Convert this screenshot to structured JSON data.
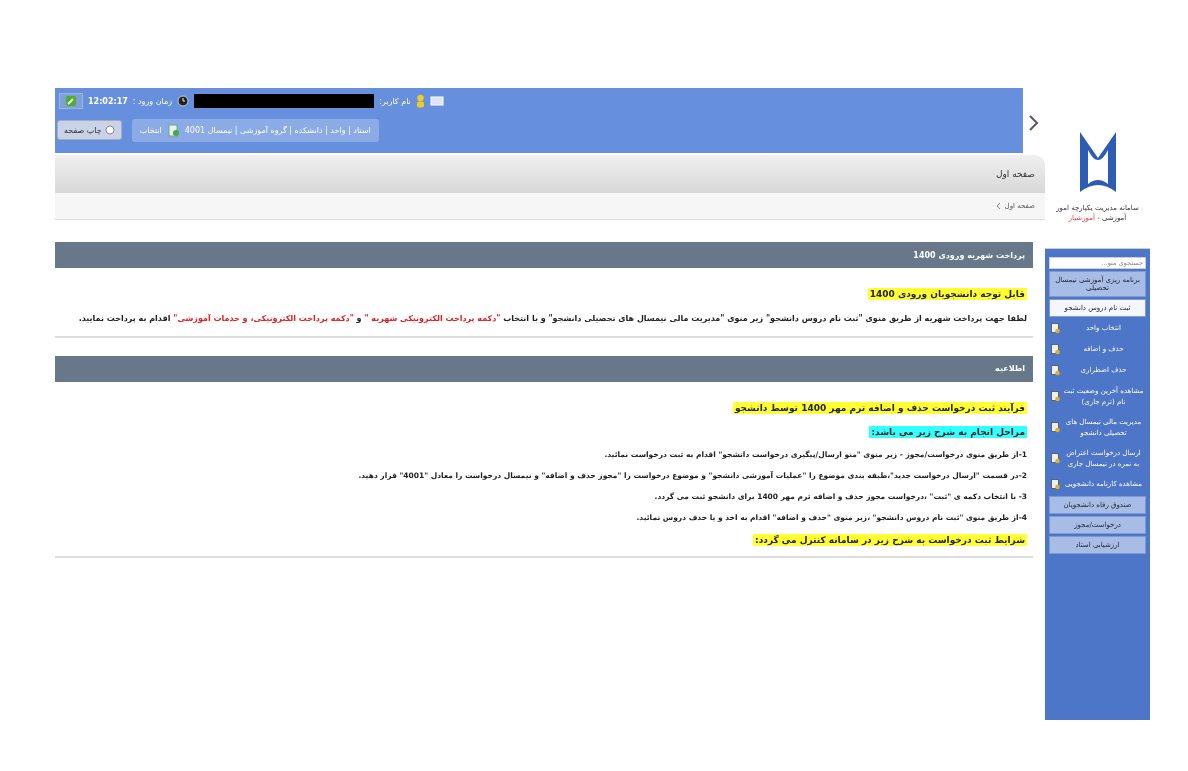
{
  "header": {
    "user_label": "نام کاربر:",
    "login_label": "زمان ورود :",
    "login_time": "12:02:17"
  },
  "toolbar": {
    "context": "استاد | واحد | دانشکده | گروه آموزشی | نیمسال 4001",
    "select_button": "انتخاب",
    "print_button": "چاپ صفحه"
  },
  "page_title": "صفحه اول",
  "breadcrumb": "صفحه اول",
  "panels": [
    {
      "title": "پرداخت شهریه ورودی 1400",
      "blocks": [
        {
          "kind": "highlight",
          "color": "#ffff33",
          "text": "قابل توجه دانشجویان ورودی 1400"
        },
        {
          "kind": "paragraph",
          "segments": [
            {
              "text": "لطفا جهت پرداخت شهریه از طریق منوی \"ثبت نام دروس دانشجو\" زیر منوی \"مدیریت مالی نیمسال های تحصیلی دانشجو\" و با انتخاب ",
              "emphasis": false
            },
            {
              "text": "\"دکمه پرداخت الکترونیکی شهریه \"",
              "emphasis": true
            },
            {
              "text": " و ",
              "emphasis": false
            },
            {
              "text": "\"دکمه پرداخت الکترونیکی، و خدمات آموزشی\"",
              "emphasis": true
            },
            {
              "text": " اقدام به پرداخت نمایید.",
              "emphasis": false
            }
          ]
        }
      ]
    },
    {
      "title": "اطلاعیه",
      "blocks": [
        {
          "kind": "highlight",
          "color": "#ffff33",
          "text": "فرآیند ثبت درخواست حذف و اضافه ترم مهر 1400 توسط دانشجو"
        },
        {
          "kind": "highlight",
          "color": "#33ffff",
          "text": "مراحل انجام به شرح زیر می باشد:"
        },
        {
          "kind": "step",
          "text": "1-از طریق منوی درخواست/مجوز - زیر منوی \"منو ارسال/پیگیری درخواست دانشجو\" اقدام به ثبت درخواست نمائید."
        },
        {
          "kind": "step",
          "text": "2-در قسمت \"ارسال درخواست جدید\"،طبقه بندی موضوع را \"عملیات آموزشی دانشجو\" و موضوع درخواست را \"مجوز حذف و اضافه\" و نیمسال درخواست را معادل \"4001\" قرار دهید."
        },
        {
          "kind": "step",
          "text": "3- با انتخاب دکمه ی \"ثبت\" ،درخواست مجوز حذف و اضافه ترم مهر 1400 برای دانشجو ثبت می گردد."
        },
        {
          "kind": "step",
          "text": "4-از طریق منوی \"ثبت نام دروس دانشجو\" ،زیر منوی \"حذف و اضافه\" اقدام به اخذ و یا حذف دروس نمائید."
        },
        {
          "kind": "highlight",
          "color": "#ffff33",
          "text": "شرایط ثبت درخواست به شرح زیر در سامانه کنترل می گردد:"
        }
      ]
    }
  ],
  "sidebar": {
    "system_name": "سامانه مدیریت یکپارچه امور آموزشی -",
    "system_sub": "آموزشیار",
    "search": {
      "placeholder": "جستجوی منو..."
    },
    "menu": [
      {
        "label": "برنامه ریزی آموزشی نیمسال تحصیلی",
        "expanded": false
      },
      {
        "label": "ثبت نام دروس دانشجو",
        "expanded": true,
        "children": [
          {
            "label": "انتخاب واحد"
          },
          {
            "label": "حذف و اضافه"
          },
          {
            "label": "حذف اضطراری"
          },
          {
            "label": "مشاهده آخرین وضعیت ثبت نام (ترم جاری)"
          },
          {
            "label": "مدیریت مالی نیمسال های تحصیلی دانشجو"
          },
          {
            "label": "ارسال درخواست اعتراض به نمره در نیمسال جاری"
          },
          {
            "label": "مشاهده کارنامه دانشجویی"
          }
        ]
      },
      {
        "label": "صندوق رفاه دانشجویان",
        "expanded": false
      },
      {
        "label": "درخواست/مجوز",
        "expanded": false
      },
      {
        "label": "ارزشیابی استاد",
        "expanded": false
      }
    ]
  }
}
